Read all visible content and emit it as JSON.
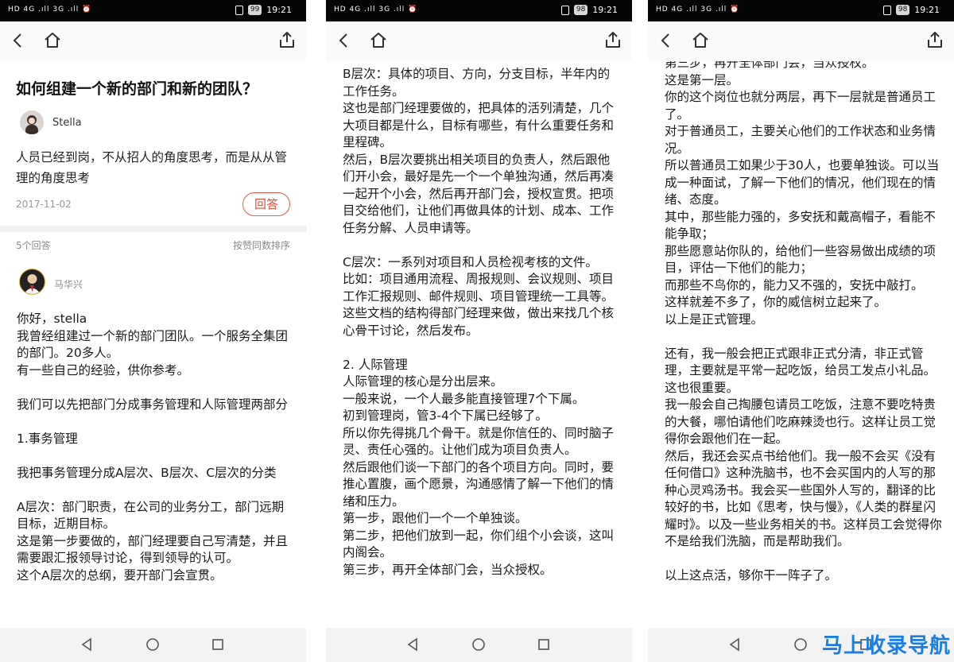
{
  "status_bar": {
    "left_icons": "HD 4G .ıll 3G .ıll ⏰",
    "time": "19:21",
    "battery_1": "99",
    "battery_2": "98",
    "battery_3": "98"
  },
  "phone1": {
    "question": {
      "title": "如何组建一个新的部门和新的团队？",
      "asker": "Stella",
      "body": "人员已经到岗，不从招人的角度思考，而是从从管理的角度思考",
      "date": "2017-11-02",
      "answer_button": "回答"
    },
    "answers_header": {
      "count": "5个回答",
      "sort": "按赞同数排序"
    },
    "answerer": "马华兴",
    "text": "你好，stella\n我曾经组建过一个新的部门团队。一个服务全集团的部门。20多人。\n有一些自己的经验，供你参考。\n\n我们可以先把部门分成事务管理和人际管理两部分\n\n1.事务管理\n\n我把事务管理分成A层次、B层次、C层次的分类\n\nA层次：部门职责，在公司的业务分工，部门远期目标，近期目标。\n这是第一步要做的，部门经理要自己写清楚，并且需要跟汇报领导讨论，得到领导的认可。\n这个A层次的总纲，要开部门会宣贯。"
  },
  "phone2": {
    "text": "B层次：具体的项目、方向，分支目标，半年内的工作任务。\n这也是部门经理要做的，把具体的活列清楚，几个大项目都是什么，目标有哪些，有什么重要任务和里程碑。\n然后，B层次要挑出相关项目的负责人，然后跟他们开小会，最好是先一个一个单独沟通，然后再凑一起开个小会，然后再开部门会，授权宣贯。把项目交给他们，让他们再做具体的计划、成本、工作任务分解、人员申请等。\n\nC层次：一系列对项目和人员检视考核的文件。\n比如：项目通用流程、周报规则、会议规则、项目工作汇报规则、邮件规则、项目管理统一工具等。\n这些文档的结构得部门经理来做，做出来找几个核心骨干讨论，然后发布。\n\n2. 人际管理\n人际管理的核心是分出层来。\n一般来说，一个人最多能直接管理7个下属。\n初到管理岗，管3-4个下属已经够了。\n所以你先得挑几个骨干。就是你信任的、同时脑子灵、责任心强的。让他们成为项目负责人。\n然后跟他们谈一下部门的各个项目方向。同时，要推心置腹，画个愿景，沟通感情了解一下他们的情绪和压力。\n第一步，跟他们一个一个单独谈。\n第二步，把他们放到一起，你们组个小会谈，这叫内阁会。\n第三步，再开全体部门会，当众授权。"
  },
  "phone3": {
    "text": "第三步，再开全体部门会，当众授权。\n这是第一层。\n你的这个岗位也就分两层，再下一层就是普通员工了。\n对于普通员工，主要关心他们的工作状态和业务情况。\n所以普通员工如果少于30人，也要单独谈。可以当成一种面试，了解一下他们的情况，他们现在的情绪、态度。\n其中，那些能力强的，多安抚和戴高帽子，看能不能争取；\n那些愿意站你队的，给他们一些容易做出成绩的项目，评估一下他们的能力；\n而那些不鸟你的，能力又不强的，安抚中敲打。\n这样就差不多了，你的威信树立起来了。\n以上是正式管理。\n\n还有，我一般会把正式跟非正式分清，非正式管理，主要就是平常一起吃饭，给员工发点小礼品。这也很重要。\n我一般会自己掏腰包请员工吃饭，注意不要吃特贵的大餐，哪怕请他们吃麻辣烫也行。这样让员工觉得你会跟他们在一起。\n然后，我还会买点书给他们。我一般不会买《没有任何借口》这种洗脑书，也不会买国内的人写的那种心灵鸡汤书。我会买一些国外人写的，翻译的比较好的书，比如《思考，快与慢》，《人类的群星闪耀时》。以及一些业务相关的书。这样员工会觉得你不是给我们洗脑，而是帮助我们。\n\n以上这点活，够你干一阵子了。"
  },
  "watermark": "马上收录导航",
  "colors": {
    "accent_red": "#e04b3e",
    "status_bar": "#050505",
    "watermark_blue": "#1a7fe0"
  }
}
